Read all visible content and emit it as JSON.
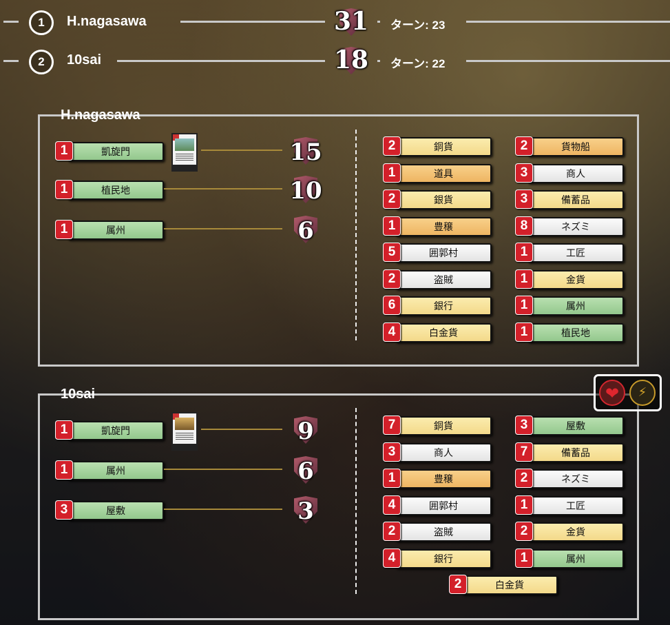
{
  "scores": [
    {
      "rank": "1",
      "name": "H.nagasawa",
      "vp": "31",
      "turns": "ターン: 23"
    },
    {
      "rank": "2",
      "name": "10sai",
      "vp": "18",
      "turns": "ターン: 22"
    }
  ],
  "players": [
    {
      "name": "H.nagasawa",
      "vp_cards": [
        {
          "count": "1",
          "label": "凱旋門",
          "vp": "15"
        },
        {
          "count": "1",
          "label": "植民地",
          "vp": "10"
        },
        {
          "count": "1",
          "label": "属州",
          "vp": "6"
        }
      ],
      "deck_left": [
        {
          "count": "2",
          "label": "銅貨",
          "color": "yellow"
        },
        {
          "count": "1",
          "label": "道具",
          "color": "orange"
        },
        {
          "count": "2",
          "label": "銀貨",
          "color": "yellow"
        },
        {
          "count": "1",
          "label": "豊穣",
          "color": "orange"
        },
        {
          "count": "5",
          "label": "囲郭村",
          "color": "white"
        },
        {
          "count": "2",
          "label": "盗賊",
          "color": "white"
        },
        {
          "count": "6",
          "label": "銀行",
          "color": "yellow"
        },
        {
          "count": "4",
          "label": "白金貨",
          "color": "yellow"
        }
      ],
      "deck_right": [
        {
          "count": "2",
          "label": "貨物船",
          "color": "orange"
        },
        {
          "count": "3",
          "label": "商人",
          "color": "white"
        },
        {
          "count": "3",
          "label": "備蓄品",
          "color": "yellow"
        },
        {
          "count": "8",
          "label": "ネズミ",
          "color": "white"
        },
        {
          "count": "1",
          "label": "工匠",
          "color": "white"
        },
        {
          "count": "1",
          "label": "金貨",
          "color": "yellow"
        },
        {
          "count": "1",
          "label": "属州",
          "color": "green"
        },
        {
          "count": "1",
          "label": "植民地",
          "color": "green"
        }
      ]
    },
    {
      "name": "10sai",
      "vp_cards": [
        {
          "count": "1",
          "label": "凱旋門",
          "vp": "9"
        },
        {
          "count": "1",
          "label": "属州",
          "vp": "6"
        },
        {
          "count": "3",
          "label": "屋敷",
          "vp": "3"
        }
      ],
      "deck_left": [
        {
          "count": "7",
          "label": "銅貨",
          "color": "yellow"
        },
        {
          "count": "3",
          "label": "商人",
          "color": "white"
        },
        {
          "count": "1",
          "label": "豊穣",
          "color": "orange"
        },
        {
          "count": "4",
          "label": "囲郭村",
          "color": "white"
        },
        {
          "count": "2",
          "label": "盗賊",
          "color": "white"
        },
        {
          "count": "4",
          "label": "銀行",
          "color": "yellow"
        }
      ],
      "deck_right": [
        {
          "count": "3",
          "label": "屋敷",
          "color": "green"
        },
        {
          "count": "7",
          "label": "備蓄品",
          "color": "yellow"
        },
        {
          "count": "2",
          "label": "ネズミ",
          "color": "white"
        },
        {
          "count": "1",
          "label": "工匠",
          "color": "white"
        },
        {
          "count": "2",
          "label": "金貨",
          "color": "yellow"
        },
        {
          "count": "1",
          "label": "属州",
          "color": "green"
        }
      ],
      "deck_bottom": [
        {
          "count": "2",
          "label": "白金貨",
          "color": "yellow"
        }
      ]
    }
  ],
  "icons": {
    "like": "heart-icon",
    "energy": "lightning-icon"
  }
}
